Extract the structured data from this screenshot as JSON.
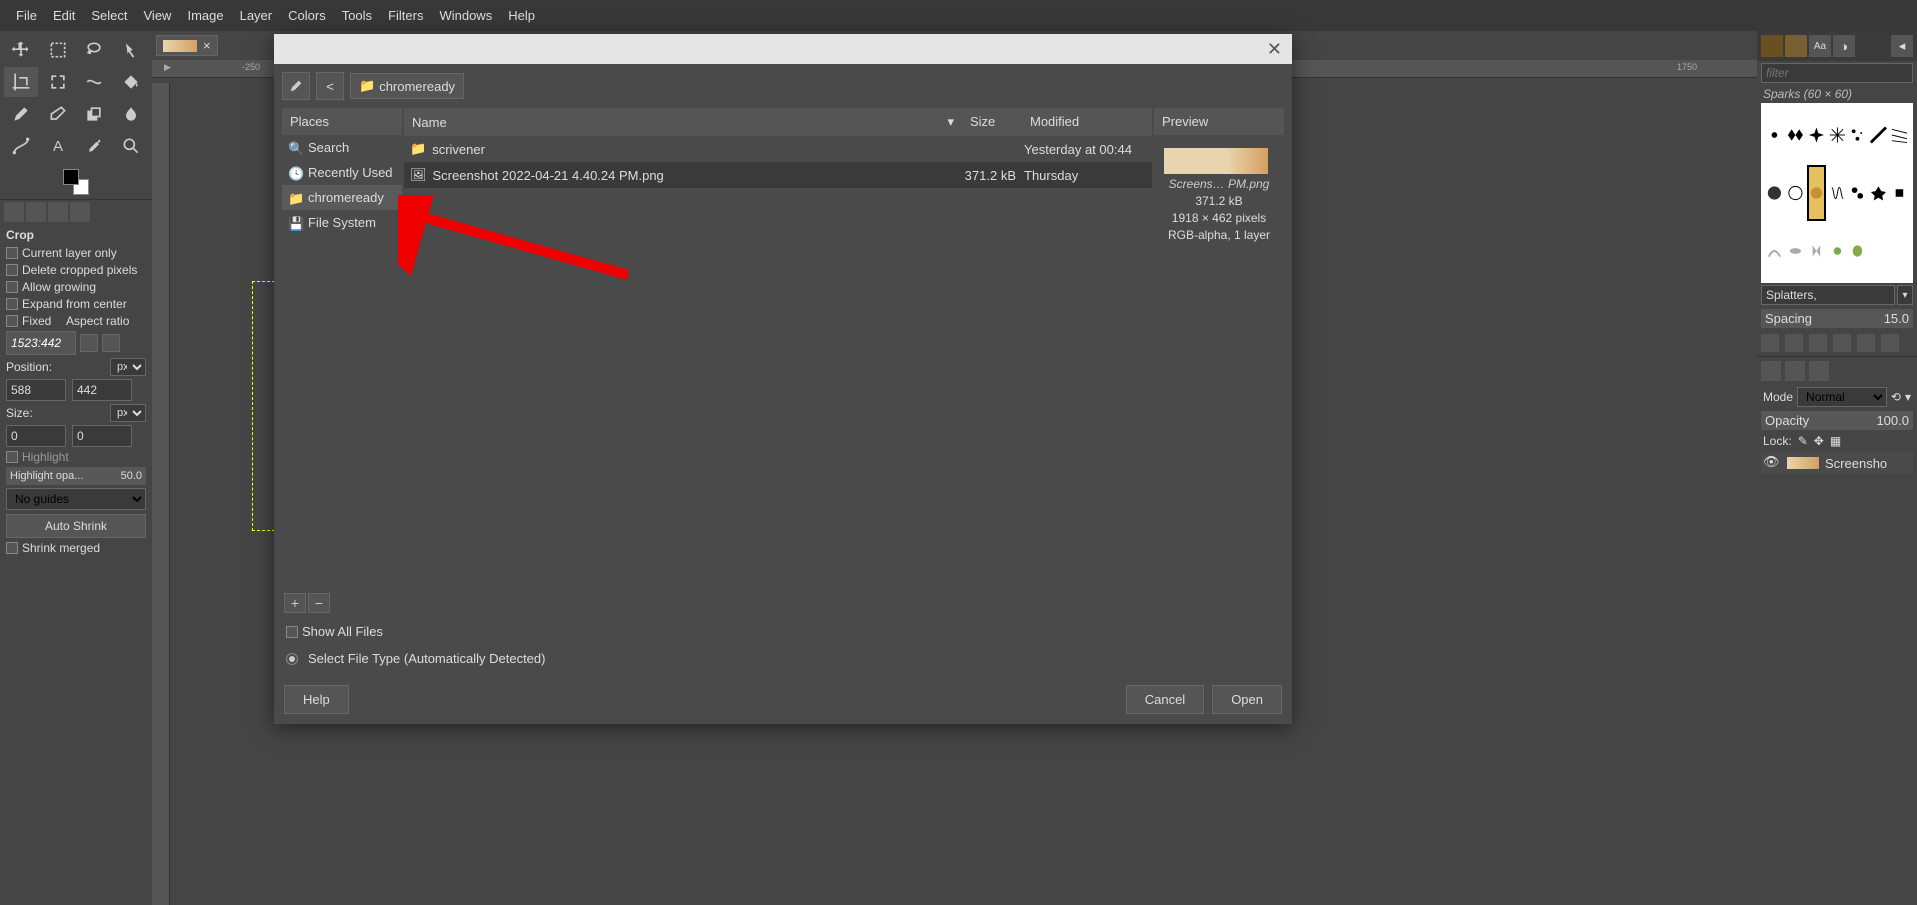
{
  "menubar": [
    "File",
    "Edit",
    "Select",
    "View",
    "Image",
    "Layer",
    "Colors",
    "Tools",
    "Filters",
    "Windows",
    "Help"
  ],
  "tool_options": {
    "title": "Crop",
    "checks": [
      "Current layer only",
      "Delete cropped pixels",
      "Allow growing",
      "Expand from center"
    ],
    "fixed_label": "Fixed",
    "aspect_label": "Aspect ratio",
    "aspect_value": "1523:442",
    "position_label": "Position:",
    "pos_unit": "px",
    "pos_x": "588",
    "pos_y": "442",
    "size_label": "Size:",
    "size_unit": "px",
    "size_w": "0",
    "size_h": "0",
    "highlight_label": "Highlight",
    "highlight_opa_label": "Highlight opa...",
    "highlight_opa_val": "50.0",
    "guides": "No guides",
    "auto_shrink": "Auto Shrink",
    "shrink_merged": "Shrink merged"
  },
  "ruler_marks": [
    "-250",
    "1750"
  ],
  "right": {
    "filter_placeholder": "filter",
    "brush_title": "Sparks (60 × 60)",
    "brush_select": "Splatters,",
    "spacing_label": "Spacing",
    "spacing_val": "15.0",
    "mode_label": "Mode",
    "mode_value": "Normal",
    "opacity_label": "Opacity",
    "opacity_val": "100.0",
    "lock_label": "Lock:",
    "layer_name": "Screensho"
  },
  "dialog": {
    "path": "chromeready",
    "places_header": "Places",
    "places": [
      {
        "label": "Search",
        "icon": "search"
      },
      {
        "label": "Recently Used",
        "icon": "recent"
      },
      {
        "label": "chromeready",
        "icon": "folder",
        "sel": true
      },
      {
        "label": "File System",
        "icon": "disk"
      }
    ],
    "file_headers": {
      "name": "Name",
      "size": "Size",
      "modified": "Modified"
    },
    "files": [
      {
        "name": "scrivener",
        "icon": "folder",
        "size": "",
        "modified": "Yesterday at 00:44"
      },
      {
        "name": "Screenshot 2022-04-21 4.40.24 PM.png",
        "icon": "image",
        "size": "371.2 kB",
        "modified": "Thursday",
        "sel": true
      }
    ],
    "preview_header": "Preview",
    "preview_filename": "Screens… PM.png",
    "preview_size": "371.2 kB",
    "preview_dims": "1918 × 462 pixels",
    "preview_mode": "RGB-alpha, 1 layer",
    "show_all": "Show All Files",
    "filetype": "Select File Type (Automatically Detected)",
    "help": "Help",
    "cancel": "Cancel",
    "open": "Open"
  }
}
